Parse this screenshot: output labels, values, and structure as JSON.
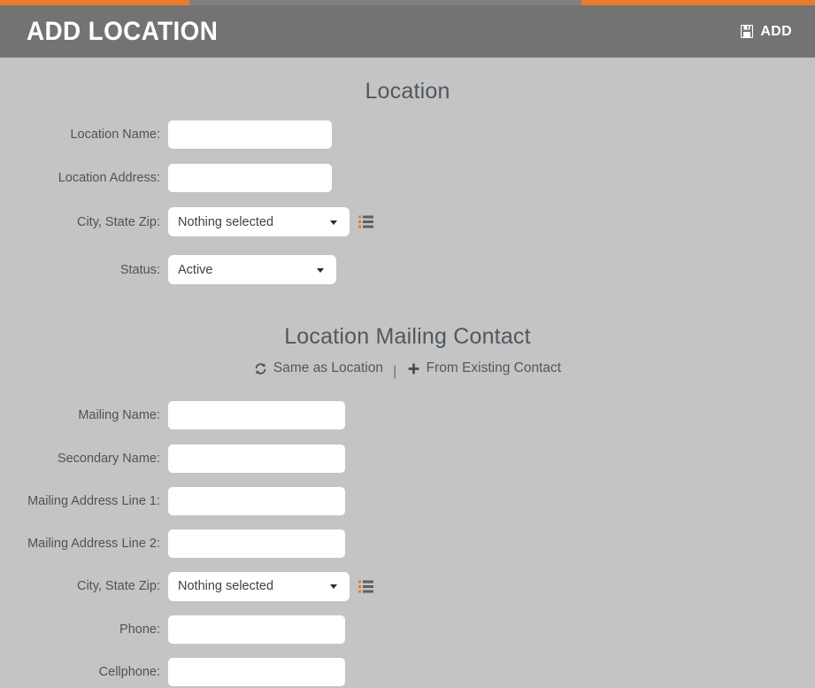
{
  "header": {
    "title": "ADD LOCATION",
    "action_label": "ADD",
    "action_icon": "save-floppy-icon",
    "bar_color": "#737373",
    "accent_color": "#ea7b2d",
    "title_color": "#ffffff"
  },
  "page": {
    "background_color": "#c4c4c4",
    "text_color": "#4c545a"
  },
  "sections": {
    "location": {
      "title": "Location",
      "fields": {
        "location_name_label": "Location Name:",
        "location_name_value": "",
        "location_address_label": "Location Address:",
        "location_address_value": "",
        "city_state_zip_label": "City, State Zip:",
        "city_state_zip_value": "Nothing selected",
        "status_label": "Status:",
        "status_value": "Active"
      }
    },
    "mailing": {
      "title": "Location Mailing Contact",
      "actions": {
        "same_as_location": "Same as Location",
        "same_as_location_icon": "sync-icon",
        "separator": "|",
        "from_existing_contact": "From Existing Contact",
        "from_existing_contact_icon": "plus-icon"
      },
      "fields": {
        "mailing_name_label": "Mailing Name:",
        "mailing_name_value": "",
        "secondary_name_label": "Secondary Name:",
        "secondary_name_value": "",
        "address_line1_label": "Mailing Address Line 1:",
        "address_line1_value": "",
        "address_line2_label": "Mailing Address Line 2:",
        "address_line2_value": "",
        "city_state_zip_label": "City, State Zip:",
        "city_state_zip_value": "Nothing selected",
        "phone_label": "Phone:",
        "phone_value": "",
        "cellphone_label": "Cellphone:",
        "cellphone_value": ""
      }
    }
  },
  "icons": {
    "zip_list_icon": "list-icon",
    "dropdown_caret": "chevron-down-icon"
  }
}
